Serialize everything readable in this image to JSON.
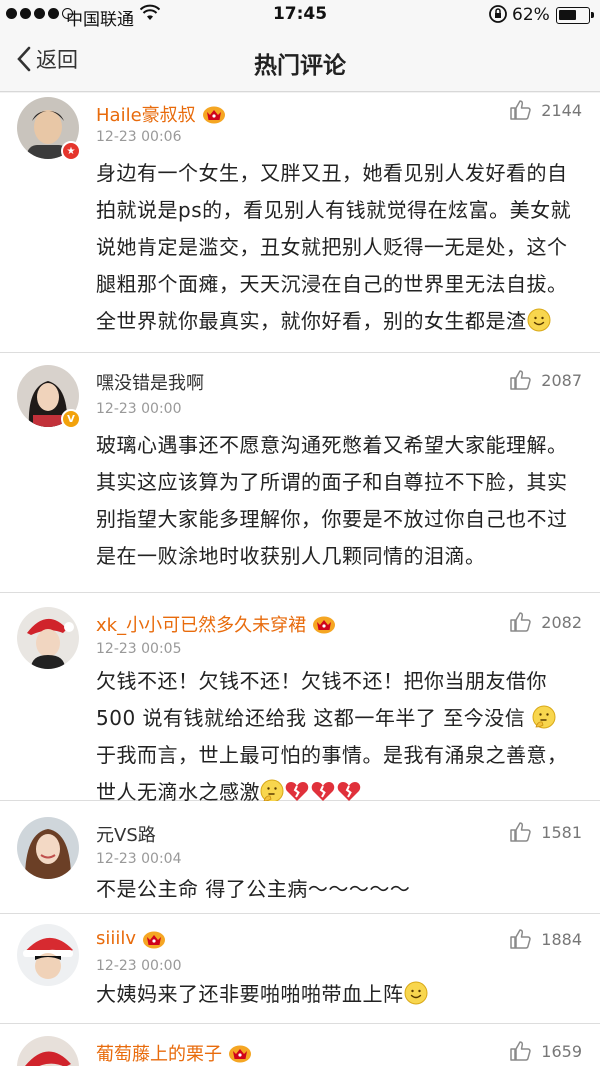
{
  "status_bar": {
    "carrier": "中国联通",
    "time": "17:45",
    "battery": "62%",
    "battery_level": 0.62
  },
  "nav": {
    "back_label": "返回",
    "title": "热门评论"
  },
  "comments": [
    {
      "name": "Haile豪叔叔",
      "date": "12-23 00:06",
      "likes": "2144",
      "text": "身边有一个女生，又胖又丑，她看见别人发好看的自拍就说是ps的，看见别人有钱就觉得在炫富。美女就说她肯定是滥交，丑女就把别人贬得一无是处，这个腿粗那个面瘫，天天沉浸在自己的世界里无法自拔。全世界就你最真实，就你好看，别的女生都是渣"
    },
    {
      "name": "嘿没错是我啊",
      "date": "12-23 00:00",
      "likes": "2087",
      "text": "玻璃心遇事还不愿意沟通死憋着又希望大家能理解。其实这应该算为了所谓的面子和自尊拉不下脸，其实别指望大家能多理解你，你要是不放过你自己也不过是在一败涂地时收获别人几颗同情的泪滴。"
    },
    {
      "name": "xk_小小可已然多久未穿裙",
      "date": "12-23 00:05",
      "likes": "2082",
      "text_a": "欠钱不还！欠钱不还！欠钱不还！把你当朋友借你500  说有钱就给还给我  这都一年半了  至今没信",
      "text_b": " 于我而言，世上最可怕的事情。是我有涌泉之善意，世人无滴水之感激"
    },
    {
      "name": "元VS路",
      "date": "12-23 00:04",
      "likes": "1581",
      "text": "不是公主命 得了公主病～～～～～"
    },
    {
      "name": "siiilv",
      "date": "12-23 00:00",
      "likes": "1884",
      "text": "大姨妈来了还非要啪啪啪带血上阵"
    },
    {
      "name": "葡萄藤上的栗子",
      "likes": "1659"
    }
  ]
}
